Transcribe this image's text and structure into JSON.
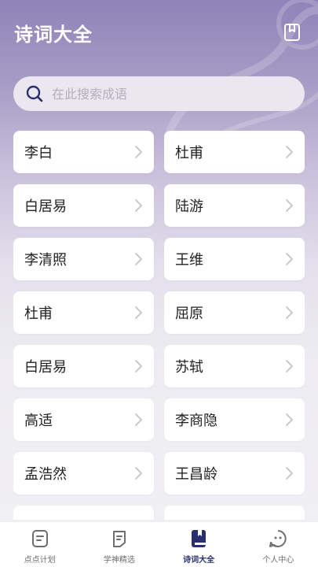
{
  "header": {
    "title": "诗词大全"
  },
  "search": {
    "placeholder": "在此搜索成语",
    "value": ""
  },
  "poets": [
    "李白",
    "杜甫",
    "白居易",
    "陆游",
    "李清照",
    "王维",
    "杜甫",
    "屈原",
    "白居易",
    "苏轼",
    "高适",
    "李商隐",
    "孟浩然",
    "王昌龄"
  ],
  "tabs": [
    {
      "label": "点点计划",
      "icon": "plan-icon",
      "active": false
    },
    {
      "label": "学神精选",
      "icon": "selection-icon",
      "active": false
    },
    {
      "label": "诗词大全",
      "icon": "book-icon",
      "active": true
    },
    {
      "label": "个人中心",
      "icon": "profile-icon",
      "active": false
    }
  ],
  "colors": {
    "accent": "#2a2f6e",
    "header_gradient_top": "#8f83b8",
    "card_bg": "#ffffff",
    "tab_inactive": "#6e6e6e"
  }
}
